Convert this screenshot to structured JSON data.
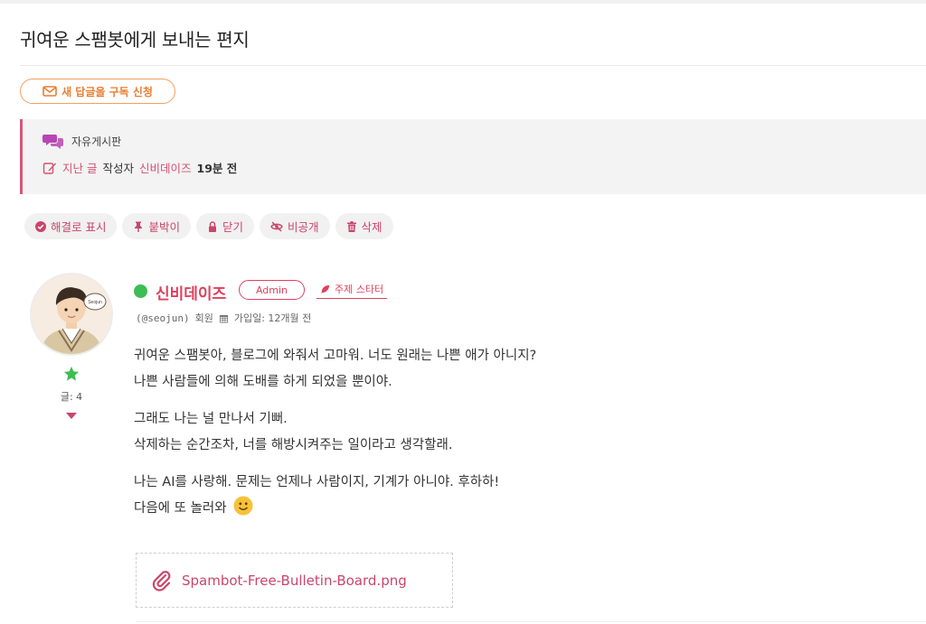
{
  "page": {
    "title": "귀여운 스팸봇에게 보내는 편지"
  },
  "subscribe": {
    "label": "새 답글을 구독 신청",
    "icon": "envelope-icon"
  },
  "info": {
    "category": "자유게시판",
    "last_post_label": "지난 글",
    "author_label": "작성자",
    "author_name": "신비데이즈",
    "time_ago": "19분 전"
  },
  "actions": [
    {
      "label": "해결로 표시",
      "icon": "check-circle-icon"
    },
    {
      "label": "붙박이",
      "icon": "pin-icon"
    },
    {
      "label": "닫기",
      "icon": "lock-icon"
    },
    {
      "label": "비공개",
      "icon": "eye-slash-icon"
    },
    {
      "label": "삭제",
      "icon": "trash-icon"
    }
  ],
  "post": {
    "author": {
      "name": "신비데이즈",
      "handle": "(@seojun)",
      "role": "회원",
      "badge": "Admin",
      "starter": "주제 스타터",
      "joined": "가입일: 12개월 전",
      "avatar_label": "Seojun",
      "posts": "글: 4",
      "status": "online"
    },
    "paragraphs": [
      {
        "line1": "귀여운 스팸봇아, 블로그에 와줘서 고마워. 너도 원래는 나쁜 애가 아니지?",
        "line2": "나쁜 사람들에 의해 도배를 하게 되었을 뿐이야."
      },
      {
        "line1": "그래도 나는 널 만나서 기뻐.",
        "line2": "삭제하는 순간조차, 너를 해방시켜주는 일이라고 생각할래."
      },
      {
        "line1": "나는 AI를 사랑해. 문제는 언제나 사람이지, 기계가 아니야. 후하하!",
        "line2": "다음에 또 놀러와"
      }
    ],
    "attachment": {
      "filename": "Spambot-Free-Bulletin-Board.png",
      "icon": "paperclip-icon"
    }
  },
  "colors": {
    "accent": "#e0405c",
    "orange": "#ea7c30",
    "online": "#3dbd53",
    "pink": "#c9466a"
  }
}
